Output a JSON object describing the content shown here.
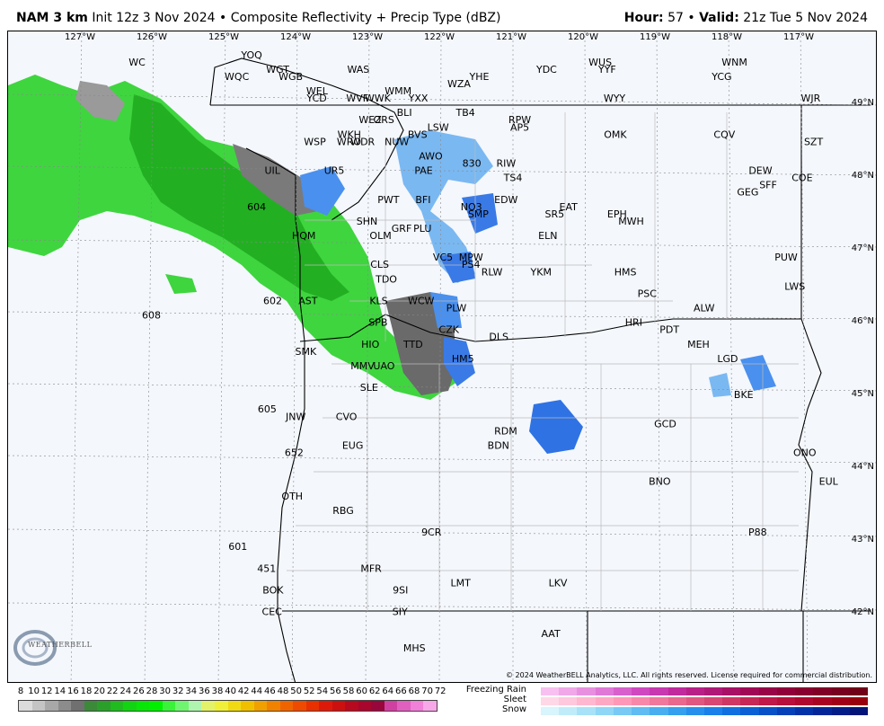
{
  "header": {
    "model": "NAM 3 km",
    "init": "Init 12z 3 Nov 2024",
    "bullet": "•",
    "product": "Composite Reflectivity + Precip Type (dBZ)",
    "hour_label": "Hour:",
    "hour_value": "57",
    "valid_label": "Valid:",
    "valid_value": "21z Tue 5 Nov 2024"
  },
  "map": {
    "lon_labels": [
      "127°W",
      "126°W",
      "125°W",
      "124°W",
      "123°W",
      "122°W",
      "121°W",
      "120°W",
      "119°W",
      "118°W",
      "117°W"
    ],
    "lat_labels": [
      "49°N",
      "48°N",
      "47°N",
      "46°N",
      "45°N",
      "44°N",
      "43°N",
      "42°N"
    ],
    "stations": [
      {
        "id": "WC",
        "lon": -126.6,
        "lat": 49.4
      },
      {
        "id": "YOQ",
        "lon": -124.9,
        "lat": 49.5
      },
      {
        "id": "WGT",
        "lon": -124.5,
        "lat": 49.3
      },
      {
        "id": "WGB",
        "lon": -124.3,
        "lat": 49.2
      },
      {
        "id": "WQC",
        "lon": -125.1,
        "lat": 49.2
      },
      {
        "id": "WAS",
        "lon": -123.3,
        "lat": 49.3
      },
      {
        "id": "WEL",
        "lon": -123.9,
        "lat": 49.0
      },
      {
        "id": "YCD",
        "lon": -123.9,
        "lat": 48.9
      },
      {
        "id": "WVF",
        "lon": -123.3,
        "lat": 48.9
      },
      {
        "id": "WMM",
        "lon": -122.7,
        "lat": 49.0
      },
      {
        "id": "WWK",
        "lon": -123.0,
        "lat": 48.9
      },
      {
        "id": "YXX",
        "lon": -122.4,
        "lat": 48.9
      },
      {
        "id": "WZA",
        "lon": -121.8,
        "lat": 49.1
      },
      {
        "id": "YHE",
        "lon": -121.5,
        "lat": 49.2
      },
      {
        "id": "YDC",
        "lon": -120.5,
        "lat": 49.3
      },
      {
        "id": "WUS",
        "lon": -119.7,
        "lat": 49.4
      },
      {
        "id": "YYF",
        "lon": -119.6,
        "lat": 49.3
      },
      {
        "id": "WNM",
        "lon": -117.7,
        "lat": 49.4
      },
      {
        "id": "YCG",
        "lon": -117.9,
        "lat": 49.2
      },
      {
        "id": "WJR",
        "lon": -116.6,
        "lat": 48.9
      },
      {
        "id": "WYY",
        "lon": -119.5,
        "lat": 48.9
      },
      {
        "id": "TB4",
        "lon": -121.7,
        "lat": 48.7
      },
      {
        "id": "RPW",
        "lon": -120.9,
        "lat": 48.6
      },
      {
        "id": "AP5",
        "lon": -120.9,
        "lat": 48.5
      },
      {
        "id": "OMK",
        "lon": -119.5,
        "lat": 48.4
      },
      {
        "id": "CQV",
        "lon": -117.9,
        "lat": 48.4
      },
      {
        "id": "WEZ",
        "lon": -123.1,
        "lat": 48.6
      },
      {
        "id": "ORS",
        "lon": -122.9,
        "lat": 48.6
      },
      {
        "id": "BLI",
        "lon": -122.6,
        "lat": 48.7
      },
      {
        "id": "LSW",
        "lon": -122.1,
        "lat": 48.5
      },
      {
        "id": "WKH",
        "lon": -123.4,
        "lat": 48.4
      },
      {
        "id": "WRO",
        "lon": -123.4,
        "lat": 48.3
      },
      {
        "id": "WDR",
        "lon": -123.2,
        "lat": 48.3
      },
      {
        "id": "NUW",
        "lon": -122.7,
        "lat": 48.3
      },
      {
        "id": "BVS",
        "lon": -122.4,
        "lat": 48.4
      },
      {
        "id": "WSP",
        "lon": -123.9,
        "lat": 48.3
      },
      {
        "id": "AWO",
        "lon": -122.2,
        "lat": 48.1
      },
      {
        "id": "830",
        "lon": -121.6,
        "lat": 48.0
      },
      {
        "id": "RIW",
        "lon": -121.1,
        "lat": 48.0
      },
      {
        "id": "SZT",
        "lon": -116.6,
        "lat": 48.3
      },
      {
        "id": "DEW",
        "lon": -117.4,
        "lat": 47.9
      },
      {
        "id": "COE",
        "lon": -116.8,
        "lat": 47.8
      },
      {
        "id": "UIL",
        "lon": -124.5,
        "lat": 47.9
      },
      {
        "id": "UR5",
        "lon": -123.6,
        "lat": 47.9
      },
      {
        "id": "PAE",
        "lon": -122.3,
        "lat": 47.9
      },
      {
        "id": "TS4",
        "lon": -121.0,
        "lat": 47.8
      },
      {
        "id": "SFF",
        "lon": -117.3,
        "lat": 47.7
      },
      {
        "id": "GEG",
        "lon": -117.6,
        "lat": 47.6
      },
      {
        "id": "PWT",
        "lon": -122.8,
        "lat": 47.5
      },
      {
        "id": "BFI",
        "lon": -122.3,
        "lat": 47.5
      },
      {
        "id": "NO3",
        "lon": -121.6,
        "lat": 47.4
      },
      {
        "id": "EDW",
        "lon": -121.1,
        "lat": 47.5
      },
      {
        "id": "EAT",
        "lon": -120.2,
        "lat": 47.4
      },
      {
        "id": "SMP",
        "lon": -121.5,
        "lat": 47.3
      },
      {
        "id": "SR5",
        "lon": -120.4,
        "lat": 47.3
      },
      {
        "id": "EPH",
        "lon": -119.5,
        "lat": 47.3
      },
      {
        "id": "MWH",
        "lon": -119.3,
        "lat": 47.2
      },
      {
        "id": "604",
        "lon": -124.7,
        "lat": 47.4
      },
      {
        "id": "SHN",
        "lon": -123.1,
        "lat": 47.2
      },
      {
        "id": "PLU",
        "lon": -122.3,
        "lat": 47.1
      },
      {
        "id": "GRF",
        "lon": -122.6,
        "lat": 47.1
      },
      {
        "id": "OLM",
        "lon": -122.9,
        "lat": 47.0
      },
      {
        "id": "ELN",
        "lon": -120.5,
        "lat": 47.0
      },
      {
        "id": "HQM",
        "lon": -124.0,
        "lat": 47.0
      },
      {
        "id": "PUW",
        "lon": -117.1,
        "lat": 46.7
      },
      {
        "id": "VC5",
        "lon": -122.0,
        "lat": 46.7
      },
      {
        "id": "MPW",
        "lon": -121.6,
        "lat": 46.7
      },
      {
        "id": "CLS",
        "lon": -122.9,
        "lat": 46.6
      },
      {
        "id": "PS4",
        "lon": -121.6,
        "lat": 46.6
      },
      {
        "id": "RLW",
        "lon": -121.3,
        "lat": 46.5
      },
      {
        "id": "YKM",
        "lon": -120.6,
        "lat": 46.5
      },
      {
        "id": "HMS",
        "lon": -119.4,
        "lat": 46.5
      },
      {
        "id": "LWS",
        "lon": -117.0,
        "lat": 46.3
      },
      {
        "id": "TDO",
        "lon": -122.8,
        "lat": 46.4
      },
      {
        "id": "PSC",
        "lon": -119.1,
        "lat": 46.2
      },
      {
        "id": "602",
        "lon": -124.4,
        "lat": 46.1
      },
      {
        "id": "AST",
        "lon": -123.9,
        "lat": 46.1
      },
      {
        "id": "KLS",
        "lon": -122.9,
        "lat": 46.1
      },
      {
        "id": "WCW",
        "lon": -122.3,
        "lat": 46.1
      },
      {
        "id": "PLW",
        "lon": -121.8,
        "lat": 46.0
      },
      {
        "id": "ALW",
        "lon": -118.3,
        "lat": 46.0
      },
      {
        "id": "608",
        "lon": -126.1,
        "lat": 45.9
      },
      {
        "id": "HRI",
        "lon": -119.3,
        "lat": 45.8
      },
      {
        "id": "SPB",
        "lon": -122.9,
        "lat": 45.8
      },
      {
        "id": "PDT",
        "lon": -118.8,
        "lat": 45.7
      },
      {
        "id": "CZK",
        "lon": -121.9,
        "lat": 45.7
      },
      {
        "id": "DLS",
        "lon": -121.2,
        "lat": 45.6
      },
      {
        "id": "HIO",
        "lon": -123.0,
        "lat": 45.5
      },
      {
        "id": "TTD",
        "lon": -122.4,
        "lat": 45.5
      },
      {
        "id": "MEH",
        "lon": -118.4,
        "lat": 45.5
      },
      {
        "id": "SMK",
        "lon": -123.9,
        "lat": 45.4
      },
      {
        "id": "HM5",
        "lon": -121.7,
        "lat": 45.3
      },
      {
        "id": "LGD",
        "lon": -118.0,
        "lat": 45.3
      },
      {
        "id": "UAO",
        "lon": -122.8,
        "lat": 45.2
      },
      {
        "id": "MMV",
        "lon": -123.1,
        "lat": 45.2
      },
      {
        "id": "SLE",
        "lon": -123.0,
        "lat": 44.9
      },
      {
        "id": "BKE",
        "lon": -117.8,
        "lat": 44.8
      },
      {
        "id": "605",
        "lon": -124.4,
        "lat": 44.6
      },
      {
        "id": "JNW",
        "lon": -124.0,
        "lat": 44.5
      },
      {
        "id": "CVO",
        "lon": -123.3,
        "lat": 44.5
      },
      {
        "id": "GCD",
        "lon": -118.9,
        "lat": 44.4
      },
      {
        "id": "RDM",
        "lon": -121.1,
        "lat": 44.3
      },
      {
        "id": "BDN",
        "lon": -121.2,
        "lat": 44.1
      },
      {
        "id": "EUG",
        "lon": -123.2,
        "lat": 44.1
      },
      {
        "id": "ONO",
        "lon": -117.0,
        "lat": 44.0
      },
      {
        "id": "652",
        "lon": -124.0,
        "lat": 44.0
      },
      {
        "id": "EUL",
        "lon": -116.7,
        "lat": 43.6
      },
      {
        "id": "BNO",
        "lon": -119.0,
        "lat": 43.6
      },
      {
        "id": "OTH",
        "lon": -124.0,
        "lat": 43.4
      },
      {
        "id": "RBG",
        "lon": -123.3,
        "lat": 43.2
      },
      {
        "id": "9CR",
        "lon": -122.1,
        "lat": 42.9
      },
      {
        "id": "P88",
        "lon": -117.7,
        "lat": 42.9
      },
      {
        "id": "601",
        "lon": -124.7,
        "lat": 42.7
      },
      {
        "id": "451",
        "lon": -124.3,
        "lat": 42.4
      },
      {
        "id": "MFR",
        "lon": -122.9,
        "lat": 42.4
      },
      {
        "id": "LMT",
        "lon": -121.7,
        "lat": 42.2
      },
      {
        "id": "LKV",
        "lon": -120.4,
        "lat": 42.2
      },
      {
        "id": "9SI",
        "lon": -122.5,
        "lat": 42.1
      },
      {
        "id": "BOK",
        "lon": -124.2,
        "lat": 42.1
      },
      {
        "id": "CEC",
        "lon": -124.2,
        "lat": 41.8
      },
      {
        "id": "SIY",
        "lon": -122.5,
        "lat": 41.8
      },
      {
        "id": "AAT",
        "lon": -120.5,
        "lat": 41.5
      },
      {
        "id": "MHS",
        "lon": -122.3,
        "lat": 41.3
      }
    ]
  },
  "copyright": "© 2024 WeatherBELL Analytics, LLC. All rights reserved. License required for commercial distribution.",
  "logo_text": "WEATHERBELL",
  "colorbar": {
    "labels": [
      "8",
      "10",
      "12",
      "14",
      "16",
      "18",
      "20",
      "22",
      "24",
      "26",
      "28",
      "30",
      "32",
      "34",
      "36",
      "38",
      "40",
      "42",
      "44",
      "46",
      "48",
      "50",
      "52",
      "54",
      "56",
      "58",
      "60",
      "62",
      "64",
      "66",
      "68",
      "70",
      "72"
    ],
    "colors": [
      "#dcdcdc",
      "#c4c4c4",
      "#a8a8a8",
      "#8c8c8c",
      "#707070",
      "#3a8a3a",
      "#2aa02a",
      "#1fbb1f",
      "#12d412",
      "#08e608",
      "#00f000",
      "#39f239",
      "#70f570",
      "#aff5af",
      "#e4f26a",
      "#f0f03a",
      "#f0da14",
      "#f0c000",
      "#f0a000",
      "#f08200",
      "#f06400",
      "#ee4a00",
      "#e83000",
      "#dd1a0a",
      "#cc1010",
      "#b80a1e",
      "#a8062c",
      "#98063c",
      "#d040a0",
      "#e060c0",
      "#f080d8",
      "#f8a8e8"
    ]
  },
  "ptype": [
    {
      "label": "Freezing Rain",
      "colors": [
        "#f8c0f0",
        "#f0a8e8",
        "#e890e0",
        "#e078d8",
        "#d860cc",
        "#d048c0",
        "#c838b0",
        "#c02a9c",
        "#b82088",
        "#b01878",
        "#a81066",
        "#a00856",
        "#980448",
        "#90003a",
        "#880030",
        "#800028",
        "#780020",
        "#700018"
      ]
    },
    {
      "label": "Sleet",
      "colors": [
        "#ffd8e8",
        "#ffc8dc",
        "#ffb8d0",
        "#ffa8c4",
        "#ff98b8",
        "#f888aa",
        "#f0789c",
        "#e8688e",
        "#e05880",
        "#d84872",
        "#d03864",
        "#c82856",
        "#c01848",
        "#b8103a",
        "#b0082e",
        "#a80422",
        "#a00018",
        "#98000e"
      ]
    },
    {
      "label": "Snow",
      "colors": [
        "#d8f4fc",
        "#c0ecfa",
        "#a8e2f8",
        "#90d6f6",
        "#78caf4",
        "#60bcf2",
        "#48aef0",
        "#34a0ee",
        "#2690ec",
        "#1a80ea",
        "#1070e0",
        "#0a60d4",
        "#0650c8",
        "#0440b8",
        "#0232a8",
        "#022698",
        "#021c88",
        "#021478"
      ]
    }
  ]
}
